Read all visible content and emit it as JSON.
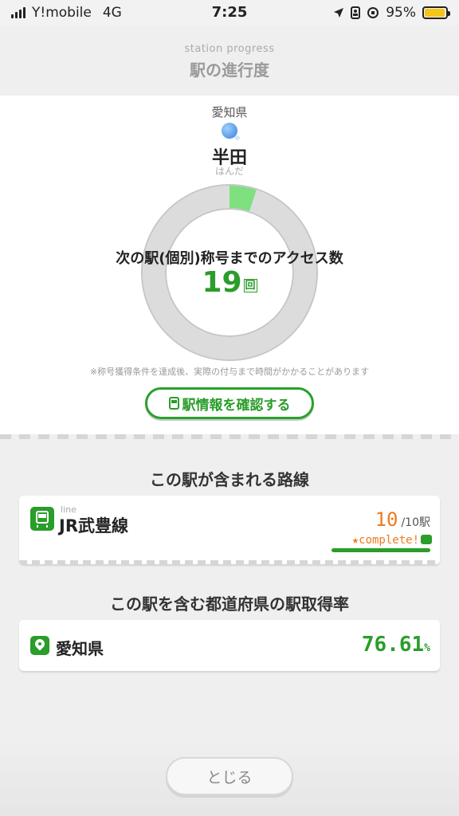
{
  "status_bar": {
    "carrier": "Y!mobile",
    "network": "4G",
    "time": "7:25",
    "battery_percent": "95%",
    "battery_level": 0.95,
    "icons": [
      "signal-icon",
      "location-arrow-icon",
      "portrait-lock-icon",
      "rotation-lock-icon",
      "battery-icon"
    ]
  },
  "header": {
    "subtitle": "station progress",
    "title": "駅の進行度"
  },
  "station": {
    "prefecture": "愛知県",
    "name": "半田",
    "kana": "はんだ"
  },
  "progress": {
    "label": "次の駅(個別)称号までのアクセス数",
    "count": "19",
    "unit": "回",
    "ring_fraction": 0.05,
    "colors": {
      "fill": "#7ee07e",
      "track": "#dcdcdc",
      "border": "#c6c6c6"
    }
  },
  "note": "※称号獲得条件を達成後、実際の付与まで時間がかかることがあります",
  "info_button": {
    "label": "駅情報を確認する"
  },
  "lines_section": {
    "title": "この駅が含まれる路線",
    "lines": [
      {
        "kicker": "line",
        "name": "JR武豊線",
        "acquired": "10",
        "total": "/10駅",
        "badge": "complete!",
        "progress": 1.0
      }
    ]
  },
  "prefecture_section": {
    "title": "この駅を含む都道府県の駅取得率",
    "name": "愛知県",
    "rate": "76.61",
    "unit": "%"
  },
  "close_button": {
    "label": "とじる"
  },
  "colors": {
    "accent_green": "#2a9d2a",
    "accent_orange": "#f07a20"
  }
}
